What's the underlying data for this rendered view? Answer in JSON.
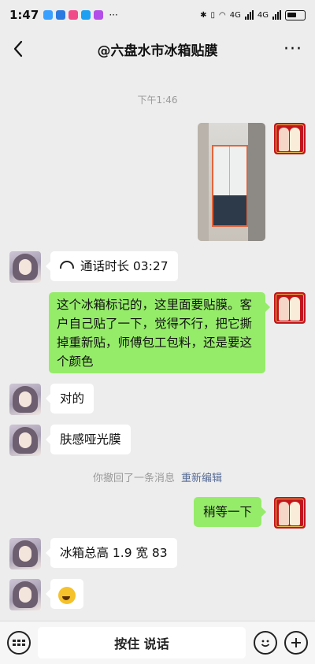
{
  "status": {
    "time": "1:47",
    "more": "···",
    "net1": "4G",
    "net2": "4G"
  },
  "header": {
    "title": "@六盘水市冰箱贴膜",
    "more": "···"
  },
  "chat": {
    "timestamp": "下午1:46",
    "call_text": "通话时长 03:27",
    "msg_long": "这个冰箱标记的，这里面要贴膜。客户自己贴了一下，觉得不行，把它撕掉重新贴，师傅包工包料，还是要这个颜色",
    "msg_yes": "对的",
    "msg_film": "肤感哑光膜",
    "recall_text": "你撤回了一条消息",
    "recall_edit": "重新编辑",
    "msg_wait": "稍等一下",
    "msg_size": "冰箱总高 1.9 宽 83"
  },
  "input": {
    "hold_to_talk": "按住 说话"
  }
}
